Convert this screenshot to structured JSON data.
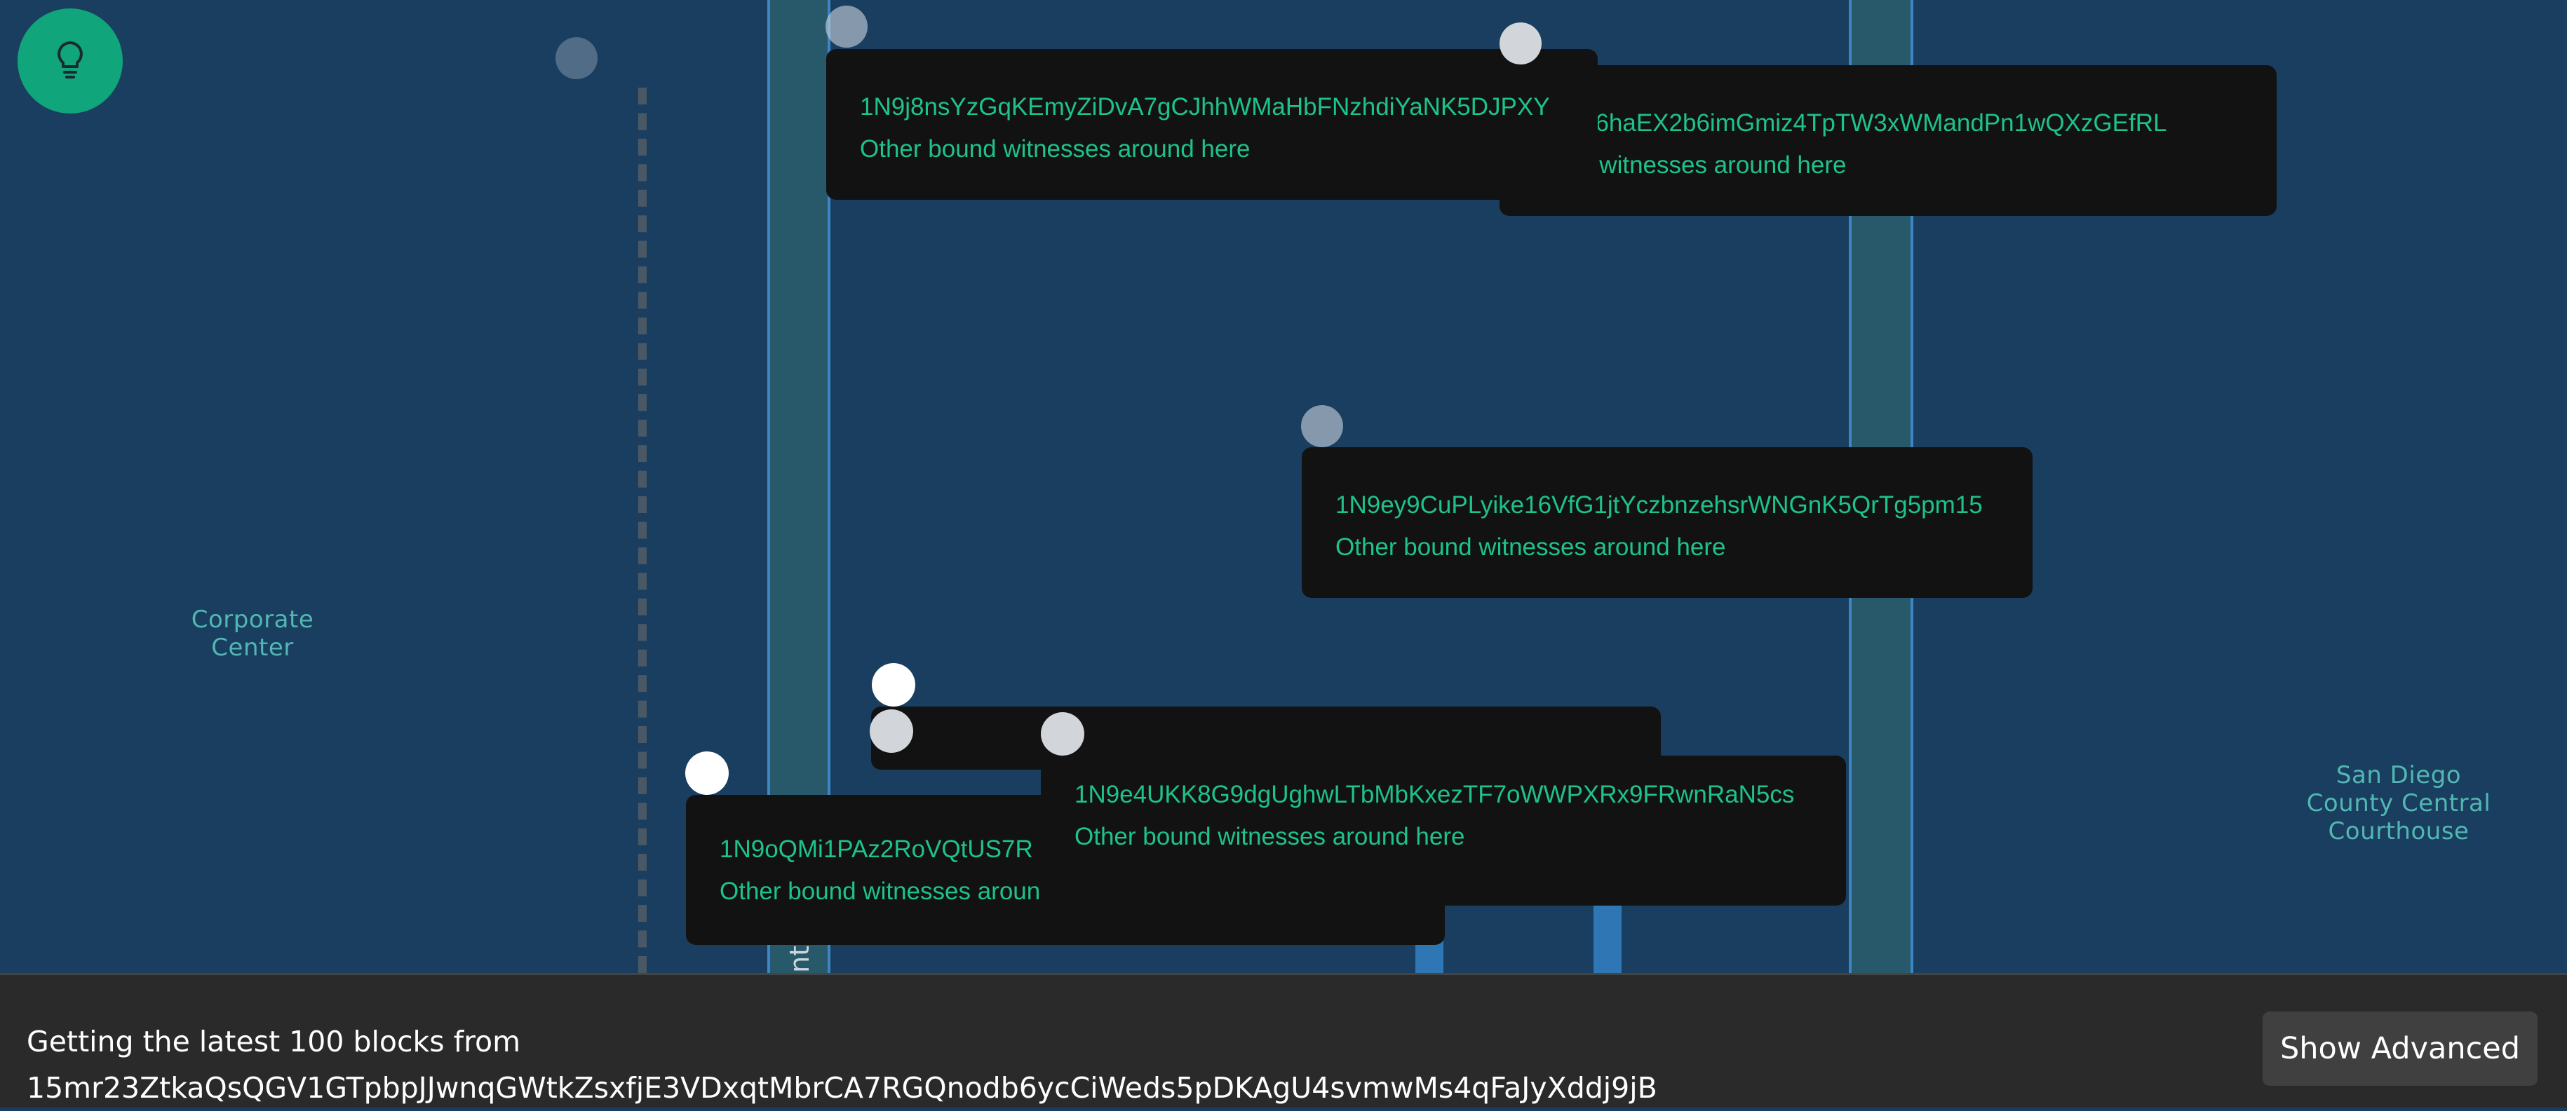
{
  "map": {
    "places": [
      "Corporate Center",
      "San Diego\nCounty Central\nCourthouse"
    ],
    "street_label": "nt"
  },
  "popups": [
    {
      "address": "1N9j8nsYzGqKEmyZiDvA7gCJhhWMaHbFNzhdiYaNK5DJPXY",
      "subtitle": "Other bound witnesses around here"
    },
    {
      "address": "1N9hP4ucfN6haEX2b6imGmiz4TpTW3xWMandPn1wQXzGEfRL",
      "subtitle": "Other bound witnesses around here"
    },
    {
      "address": "1N9ey9CuPLyike16VfG1jtYczbnzehsrWNGnK5QrTg5pm15",
      "subtitle": "Other bound witnesses around here"
    },
    {
      "address": "1N9oQMi1PAz2RoVQtUS7R",
      "subtitle": "Other bound witnesses aroun"
    },
    {
      "address": "1N9e4UKK8G9dgUghwLTbMbKxezTF7oWWPXRx9FRwnRaN5cs",
      "subtitle": "Other bound witnesses around here"
    }
  ],
  "footer": {
    "status_line1": "Getting the latest 100 blocks from",
    "status_line2": "15mr23ZtkaQsQGV1GTpbpJJwnqGWtkZsxfjE3VDxqtMbrCA7RGQnodb6ycCiWeds5pDKAgU4svmwMs4qFaJyXddj9jB",
    "advanced_label": "Show Advanced"
  },
  "icons": {
    "tip": "lightbulb-icon"
  }
}
